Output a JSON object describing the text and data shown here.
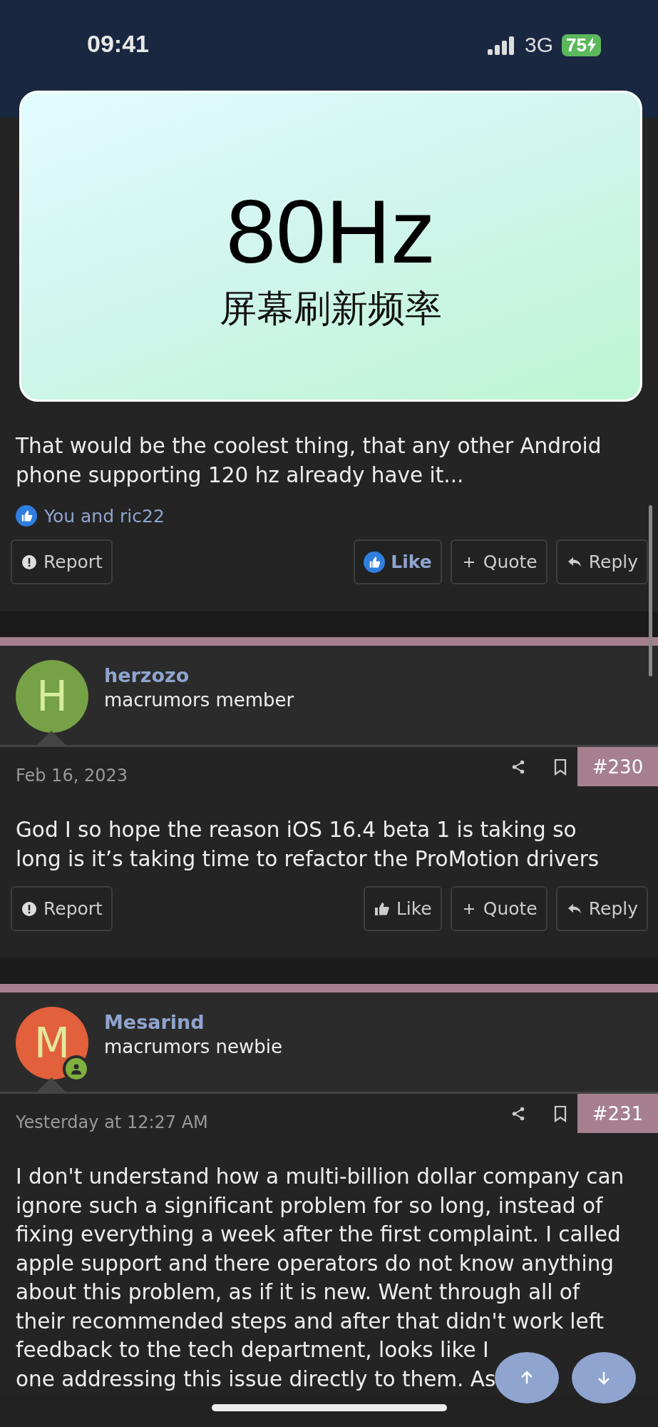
{
  "status_bar": {
    "time": "09:41",
    "network": "3G",
    "battery": "75"
  },
  "overlay": {
    "value": "80Hz",
    "label": "屏幕刷新频率"
  },
  "posts": [
    {
      "lines": [
        "That would be the coolest thing, that any other Android",
        "phone supporting 120 hz already have it..."
      ],
      "reactions": "You and ric22",
      "actions": [
        {
          "kind": "report",
          "label": "Report"
        },
        {
          "kind": "like",
          "label": "Like",
          "selected": true
        },
        {
          "kind": "quote",
          "label": "Quote"
        },
        {
          "kind": "reply",
          "label": "Reply"
        }
      ]
    },
    {
      "author": "herzozo",
      "role": "macrumors member",
      "avatar": {
        "letter": "H",
        "color": "#76a146",
        "online": false
      },
      "date": "Feb 16, 2023",
      "number": "#230",
      "lines": [
        "God I so hope the reason iOS 16.4 beta 1 is taking so",
        "long is it’s taking time to refactor the ProMotion drivers"
      ],
      "actions": [
        {
          "kind": "report",
          "label": "Report"
        },
        {
          "kind": "like",
          "label": "Like",
          "selected": false
        },
        {
          "kind": "quote",
          "label": "Quote"
        },
        {
          "kind": "reply",
          "label": "Reply"
        }
      ]
    },
    {
      "author": "Mesarind",
      "role": "macrumors newbie",
      "avatar": {
        "letter": "M",
        "color": "#e2603b",
        "online": true
      },
      "date": "Yesterday at 12:27 AM",
      "number": "#231",
      "lines": [
        "I don't understand how a multi-billion dollar company can",
        "ignore such a significant problem for so long, instead of",
        "fixing everything a week after the first complaint. I called",
        "apple support and there operators do not know anything",
        "about this problem, as if it is new. Went through all of",
        "their recommended steps and after that didn't work left",
        "feedback to the tech department, looks like I",
        "one addressing this issue directly to them. As"
      ]
    }
  ]
}
